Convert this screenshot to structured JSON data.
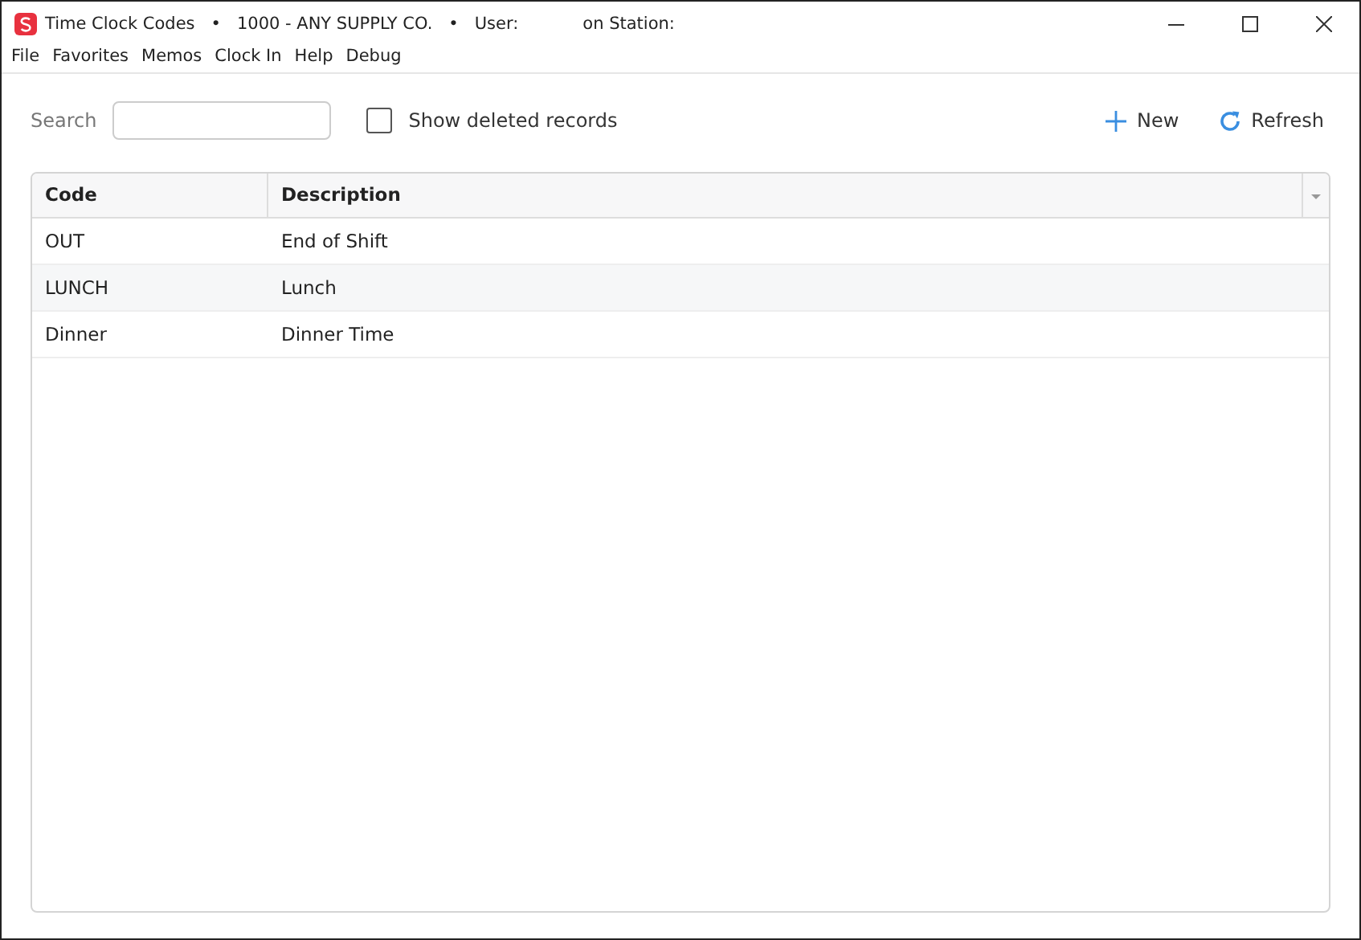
{
  "window": {
    "title_parts": [
      "Time Clock Codes",
      "•",
      "1000 - ANY SUPPLY CO.",
      "•",
      "User:",
      "on Station:"
    ]
  },
  "menu": [
    "File",
    "Favorites",
    "Memos",
    "Clock In",
    "Help",
    "Debug"
  ],
  "toolbar": {
    "search_label": "Search",
    "show_deleted": {
      "label": "Show deleted records",
      "checked": false
    },
    "new_button": "New",
    "refresh_button": "Refresh"
  },
  "table": {
    "columns": [
      "Code",
      "Description"
    ],
    "rows": [
      {
        "code": "OUT",
        "description": "End of Shift"
      },
      {
        "code": "LUNCH",
        "description": "Lunch"
      },
      {
        "code": "Dinner",
        "description": "Dinner Time"
      }
    ]
  }
}
